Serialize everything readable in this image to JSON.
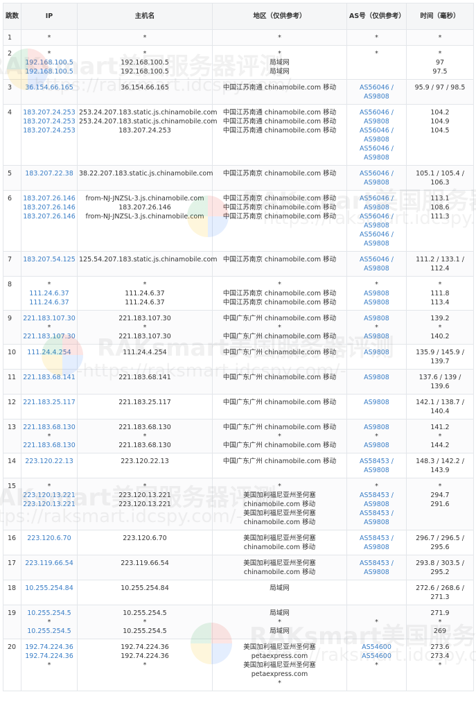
{
  "headers": {
    "hop": "跳数",
    "ip": "IP",
    "host": "主机名",
    "region": "地区（仅供参考）",
    "as": "AS号（仅供参考）",
    "time": "时间（毫秒）"
  },
  "watermark": {
    "brand": "RAKsmart美国服务器评测",
    "url": "-https://raksmart.idcspy.com/-"
  },
  "rows": [
    {
      "hop": "1",
      "ip": [
        "*"
      ],
      "host": [
        "*"
      ],
      "region": [
        "*"
      ],
      "as": [
        "*"
      ],
      "time": [
        "*"
      ]
    },
    {
      "hop": "2",
      "ip": [
        "*",
        "192.168.100.5",
        "192.168.100.5"
      ],
      "host": [
        "*",
        "192.168.100.5",
        "192.168.100.5"
      ],
      "region": [
        "*",
        "局域网",
        "局域网"
      ],
      "as": [
        "*"
      ],
      "time": [
        "*",
        "97",
        "97.5"
      ]
    },
    {
      "hop": "3",
      "ip": [
        "36.154.66.165"
      ],
      "host": [
        "36.154.66.165"
      ],
      "region": [
        "中国江苏南通 chinamobile.com 移动"
      ],
      "as": [
        "AS56046 /",
        "AS9808"
      ],
      "time": [
        "95.9 / 97 / 98.5"
      ]
    },
    {
      "hop": "4",
      "ip": [
        "183.207.24.253",
        "183.207.24.253",
        "183.207.24.253"
      ],
      "host": [
        "253.24.207.183.static.js.chinamobile.com",
        "253.24.207.183.static.js.chinamobile.com",
        "183.207.24.253"
      ],
      "region": [
        "中国江苏南通 chinamobile.com 移动",
        "中国江苏南通 chinamobile.com 移动",
        "中国江苏南通 chinamobile.com 移动"
      ],
      "as": [
        "AS56046 /",
        "AS9808",
        "AS56046 /",
        "AS9808",
        "AS56046 /",
        "AS9808"
      ],
      "time": [
        "104.2",
        "104.9",
        "104.5"
      ]
    },
    {
      "hop": "5",
      "ip": [
        "183.207.22.38"
      ],
      "host": [
        "38.22.207.183.static.js.chinamobile.com"
      ],
      "region": [
        "中国江苏南京 chinamobile.com 移动"
      ],
      "as": [
        "AS56046 /",
        "AS9808"
      ],
      "time": [
        "105.1 / 105.4 /",
        "106.3"
      ]
    },
    {
      "hop": "6",
      "ip": [
        "183.207.26.146",
        "183.207.26.146",
        "183.207.26.146"
      ],
      "host": [
        "from-NJ-JNZSL-3.js.chinamobile.com",
        "183.207.26.146",
        "from-NJ-JNZSL-3.js.chinamobile.com"
      ],
      "region": [
        "中国江苏南京 chinamobile.com 移动",
        "中国江苏南京 chinamobile.com 移动",
        "中国江苏南京 chinamobile.com 移动"
      ],
      "as": [
        "AS56046 /",
        "AS9808",
        "AS56046 /",
        "AS9808",
        "AS56046 /",
        "AS9808"
      ],
      "time": [
        "113.1",
        "108.6",
        "111.3"
      ]
    },
    {
      "hop": "7",
      "ip": [
        "183.207.54.125"
      ],
      "host": [
        "125.54.207.183.static.js.chinamobile.com"
      ],
      "region": [
        "中国江苏南京 chinamobile.com 移动"
      ],
      "as": [
        "AS56046 /",
        "AS9808"
      ],
      "time": [
        "111.2 / 133.1 /",
        "112.4"
      ]
    },
    {
      "hop": "8",
      "ip": [
        "*",
        "111.24.6.37",
        "111.24.6.37"
      ],
      "host": [
        "*",
        "111.24.6.37",
        "111.24.6.37"
      ],
      "region": [
        "*",
        "中国江苏南京 chinamobile.com 移动",
        "中国江苏南京 chinamobile.com 移动"
      ],
      "as": [
        "*",
        "AS9808",
        "AS9808"
      ],
      "time": [
        "*",
        "111.8",
        "113.4"
      ]
    },
    {
      "hop": "9",
      "ip": [
        "221.183.107.30",
        "*",
        "221.183.107.30"
      ],
      "host": [
        "221.183.107.30",
        "*",
        "221.183.107.30"
      ],
      "region": [
        "中国广东广州 chinamobile.com 移动",
        "*",
        "中国广东广州 chinamobile.com 移动"
      ],
      "as": [
        "AS9808",
        "*",
        "AS9808"
      ],
      "time": [
        "139.2",
        "*",
        "140.2"
      ]
    },
    {
      "hop": "10",
      "ip": [
        "111.24.4.254"
      ],
      "host": [
        "111.24.4.254"
      ],
      "region": [
        "中国广东广州 chinamobile.com 移动"
      ],
      "as": [
        "AS9808"
      ],
      "time": [
        "135.9 / 145.9 /",
        "139.7"
      ]
    },
    {
      "hop": "11",
      "ip": [
        "221.183.68.141"
      ],
      "host": [
        "221.183.68.141"
      ],
      "region": [
        "中国广东广州 chinamobile.com 移动"
      ],
      "as": [
        "AS9808"
      ],
      "time": [
        "137.6 / 139 /",
        "139.6"
      ]
    },
    {
      "hop": "12",
      "ip": [
        "221.183.25.117"
      ],
      "host": [
        "221.183.25.117"
      ],
      "region": [
        "中国广东广州 chinamobile.com 移动"
      ],
      "as": [
        "AS9808"
      ],
      "time": [
        "142.1 / 138.7 /",
        "140.4"
      ]
    },
    {
      "hop": "13",
      "ip": [
        "221.183.68.130",
        "*",
        "221.183.68.130"
      ],
      "host": [
        "221.183.68.130",
        "*",
        "221.183.68.130"
      ],
      "region": [
        "中国广东广州 chinamobile.com 移动",
        "*",
        "中国广东广州 chinamobile.com 移动"
      ],
      "as": [
        "AS9808",
        "*",
        "AS9808"
      ],
      "time": [
        "141.2",
        "*",
        "144.2"
      ]
    },
    {
      "hop": "14",
      "ip": [
        "223.120.22.13"
      ],
      "host": [
        "223.120.22.13"
      ],
      "region": [
        "中国广东广州 chinamobile.com 移动"
      ],
      "as": [
        "AS58453 /",
        "AS9808"
      ],
      "time": [
        "148.3 / 142.2 /",
        "143.9"
      ]
    },
    {
      "hop": "15",
      "ip": [
        "*",
        "223.120.13.221",
        "223.120.13.221"
      ],
      "host": [
        "*",
        "223.120.13.221",
        "223.120.13.221"
      ],
      "region": [
        "*",
        "美国加利福尼亚州圣何塞",
        "chinamobile.com 移动",
        "美国加利福尼亚州圣何塞",
        "chinamobile.com 移动"
      ],
      "as": [
        "*",
        "AS58453 /",
        "AS9808",
        "AS58453 /",
        "AS9808"
      ],
      "time": [
        "*",
        "294.7",
        "291.6"
      ]
    },
    {
      "hop": "16",
      "ip": [
        "223.120.6.70"
      ],
      "host": [
        "223.120.6.70"
      ],
      "region": [
        "美国加利福尼亚州圣何塞",
        "chinamobile.com 移动"
      ],
      "as": [
        "AS58453 /",
        "AS9808"
      ],
      "time": [
        "296.7 / 296.5 /",
        "295.6"
      ]
    },
    {
      "hop": "17",
      "ip": [
        "223.119.66.54"
      ],
      "host": [
        "223.119.66.54"
      ],
      "region": [
        "美国加利福尼亚州圣何塞",
        "chinamobile.com 移动"
      ],
      "as": [
        "AS58453 /",
        "AS9808"
      ],
      "time": [
        "293.8 / 303.5 /",
        "295.2"
      ]
    },
    {
      "hop": "18",
      "ip": [
        "10.255.254.84"
      ],
      "host": [
        "10.255.254.84"
      ],
      "region": [
        "局域网"
      ],
      "as": [],
      "time": [
        "272.6 / 268.6 /",
        "271.3"
      ]
    },
    {
      "hop": "19",
      "ip": [
        "10.255.254.5",
        "*",
        "10.255.254.5"
      ],
      "host": [
        "10.255.254.5",
        "*",
        "10.255.254.5"
      ],
      "region": [
        "局域网",
        "*",
        "局域网"
      ],
      "as": [
        "",
        "*",
        ""
      ],
      "time": [
        "271.9",
        "*",
        "269"
      ]
    },
    {
      "hop": "20",
      "ip": [
        "192.74.224.36",
        "192.74.224.36",
        "*"
      ],
      "host": [
        "192.74.224.36",
        "192.74.224.36",
        "*"
      ],
      "region": [
        "美国加利福尼亚州圣何塞",
        "petaexpress.com",
        "美国加利福尼亚州圣何塞",
        "petaexpress.com",
        "*"
      ],
      "as": [
        "AS54600",
        "AS54600",
        "*"
      ],
      "time": [
        "273.6",
        "273.4",
        "*"
      ]
    }
  ]
}
